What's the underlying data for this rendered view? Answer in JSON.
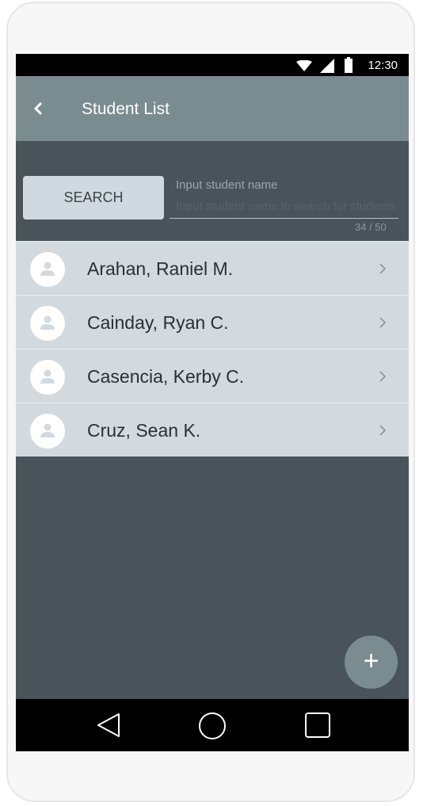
{
  "status_bar": {
    "time": "12:30",
    "icons": [
      "wifi-icon",
      "signal-icon",
      "battery-icon"
    ]
  },
  "app_bar": {
    "title": "Student List",
    "back_icon": "chevron-left-icon"
  },
  "search": {
    "button_label": "SEARCH",
    "input_label": "Input student name",
    "input_value": "Input student name to search for students",
    "counter": "34 / 50"
  },
  "students": [
    {
      "name": "Arahan, Raniel M."
    },
    {
      "name": "Cainday, Ryan C."
    },
    {
      "name": "Casencia, Kerby C."
    },
    {
      "name": "Cruz, Sean K."
    }
  ],
  "fab": {
    "label": "+"
  },
  "nav_bar": {
    "icons": [
      "nav-back-icon",
      "nav-home-icon",
      "nav-recent-apps-icon"
    ]
  },
  "colors": {
    "app_bar": "#7a8c90",
    "background": "#485459",
    "list_item": "#d2dadf",
    "button": "#d0d9df"
  }
}
